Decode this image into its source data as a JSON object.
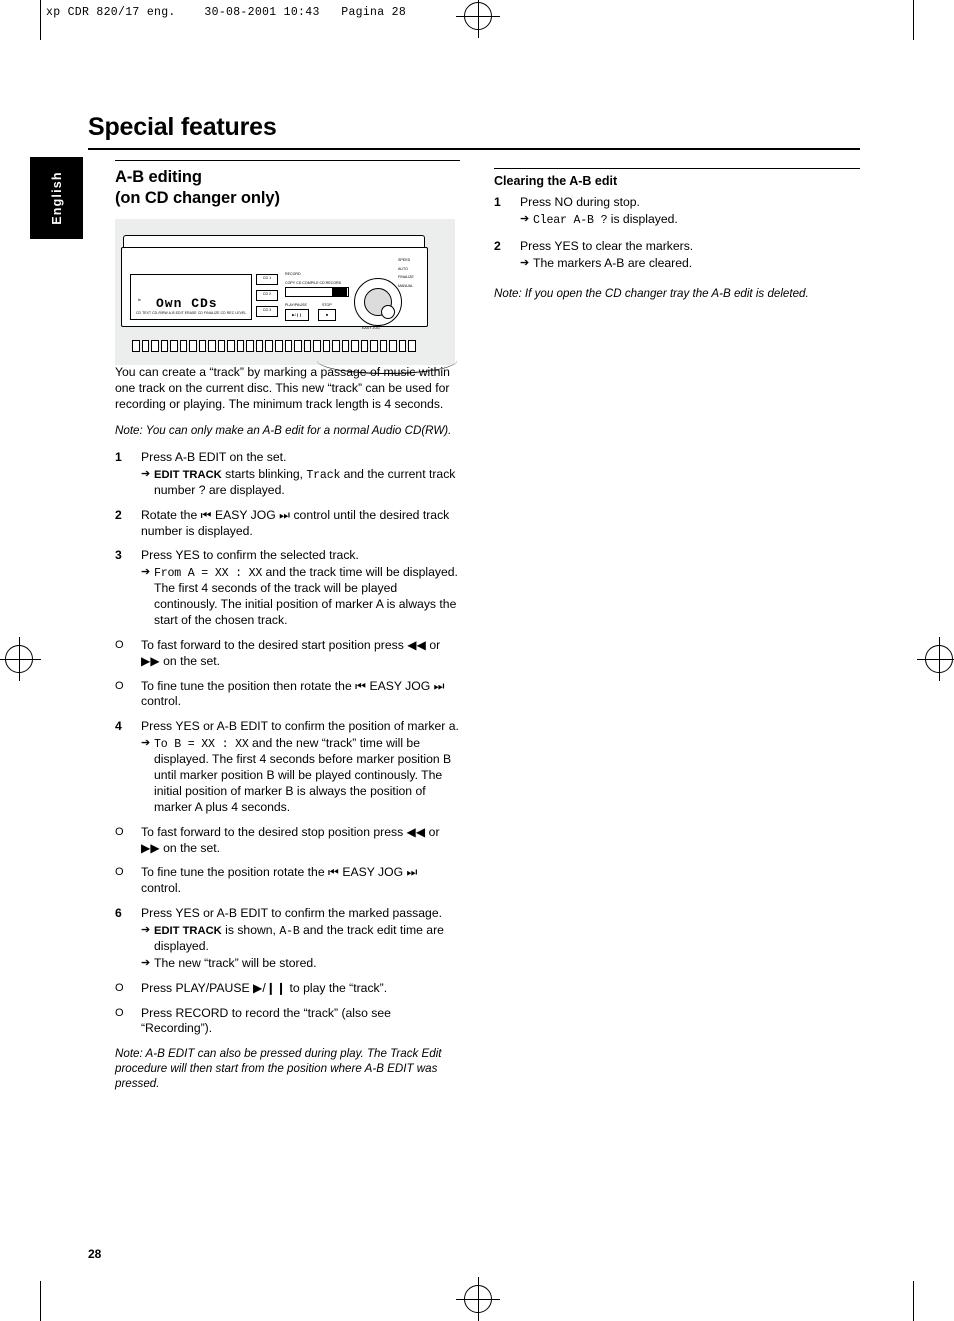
{
  "slug": "xp CDR 820/17 eng.    30-08-2001 10:43   Pagina 28",
  "language_tab": "English",
  "page_title": "Special features",
  "folio": "28",
  "left": {
    "heading_line1": "A-B editing",
    "heading_line2": "(on CD changer only)",
    "illustration": {
      "display_main": "Own CDs",
      "display_top_labels": "te",
      "display_bottom_labels": "CD TEXT  CD-R/RW  A-B EDIT  ERASE CD  FINALIZE CD  REC LEVEL",
      "button_cd1": "CD 1",
      "button_cd2": "CD 2",
      "button_cd3": "CD 3",
      "label_record": "RECORD",
      "label_copy": "COPY CD COMPILE CD RECORD",
      "label_playpause": "PLAY/PAUSE",
      "label_stop": "STOP",
      "label_playpause_btn": "▶/❙❙",
      "label_stop_btn": "■",
      "label_speed": "SPEED",
      "label_auto": "AUTO",
      "label_finalize": "FINALIZE",
      "label_manual": "MANUAL",
      "label_easyjog": "EASY JOG"
    },
    "intro": "You can create a “track” by marking a passage of music within one track on the current disc. This new “track” can be used for recording or playing. The minimum track length is 4 seconds.",
    "note_intro": "Note: You can only make an A-B edit for a normal Audio CD(RW).",
    "steps": [
      {
        "num": "1",
        "text": "Press A-B EDIT on the set.",
        "subs": [
          {
            "parts": [
              {
                "t": "EDIT TRACK",
                "s": "bold"
              },
              {
                "t": " starts blinking, ",
                "s": "plain"
              },
              {
                "t": "Track",
                "s": "mono"
              },
              {
                "t": " and the current track number ? are displayed.",
                "s": "plain"
              }
            ]
          }
        ]
      },
      {
        "num": "2",
        "text": "Rotate the ⏮ EASY JOG ⏭ control until the desired track number is displayed.",
        "subs": []
      },
      {
        "num": "3",
        "text": "Press YES to confirm the selected track.",
        "subs": [
          {
            "parts": [
              {
                "t": "From A = XX : XX",
                "s": "mono"
              },
              {
                "t": " and the track time will be displayed. The first 4 seconds of the track will be played continously. The initial position of marker A is always the start of the chosen track.",
                "s": "plain"
              }
            ]
          }
        ]
      },
      {
        "num": "O",
        "bullet": true,
        "text": "To fast forward to the desired start position press ◀◀ or ▶▶ on the set.",
        "subs": []
      },
      {
        "num": "O",
        "bullet": true,
        "text": "To fine tune the position then rotate the ⏮ EASY JOG ⏭ control.",
        "subs": []
      },
      {
        "num": "4",
        "text": "Press YES or A-B EDIT to confirm the position of marker a.",
        "subs": [
          {
            "parts": [
              {
                "t": "To B = XX : XX",
                "s": "mono"
              },
              {
                "t": " and the new “track” time will be displayed. The first 4 seconds before marker position B until marker position B will be played continously. The initial position of marker B is always the position of marker A plus 4 seconds.",
                "s": "plain"
              }
            ]
          }
        ]
      },
      {
        "num": "O",
        "bullet": true,
        "text": "To fast forward to the desired stop position press ◀◀ or ▶▶ on the set.",
        "subs": []
      },
      {
        "num": "O",
        "bullet": true,
        "text": "To fine tune the position rotate the ⏮ EASY JOG ⏭ control.",
        "subs": []
      },
      {
        "num": "6",
        "text": "Press YES or A-B EDIT to confirm the marked passage.",
        "subs": [
          {
            "parts": [
              {
                "t": "EDIT TRACK",
                "s": "bold"
              },
              {
                "t": " is shown, ",
                "s": "plain"
              },
              {
                "t": "A-B",
                "s": "mono"
              },
              {
                "t": " and the track edit time are displayed.",
                "s": "plain"
              }
            ]
          },
          {
            "parts": [
              {
                "t": "The new “track” will be stored.",
                "s": "plain"
              }
            ]
          }
        ]
      },
      {
        "num": "O",
        "bullet": true,
        "text": "Press PLAY/PAUSE ▶/❙❙ to play the “track”.",
        "subs": []
      },
      {
        "num": "O",
        "bullet": true,
        "text": "Press RECORD to record the “track” (also see “Recording”).",
        "subs": []
      }
    ],
    "note_end": "Note: A-B EDIT can also be pressed during play. The Track Edit procedure will then start from the position where A-B EDIT was pressed."
  },
  "right": {
    "heading": "Clearing the A-B edit",
    "steps": [
      {
        "num": "1",
        "text": "Press NO during stop.",
        "subs": [
          {
            "parts": [
              {
                "t": "Clear A-B ?",
                "s": "mono"
              },
              {
                "t": " is displayed.",
                "s": "plain"
              }
            ]
          }
        ]
      },
      {
        "num": "2",
        "text": "Press YES to clear the markers.",
        "subs": [
          {
            "parts": [
              {
                "t": "The markers A-B are cleared.",
                "s": "plain"
              }
            ]
          }
        ]
      }
    ],
    "note": "Note: If you open the CD changer tray the A-B edit is deleted."
  }
}
